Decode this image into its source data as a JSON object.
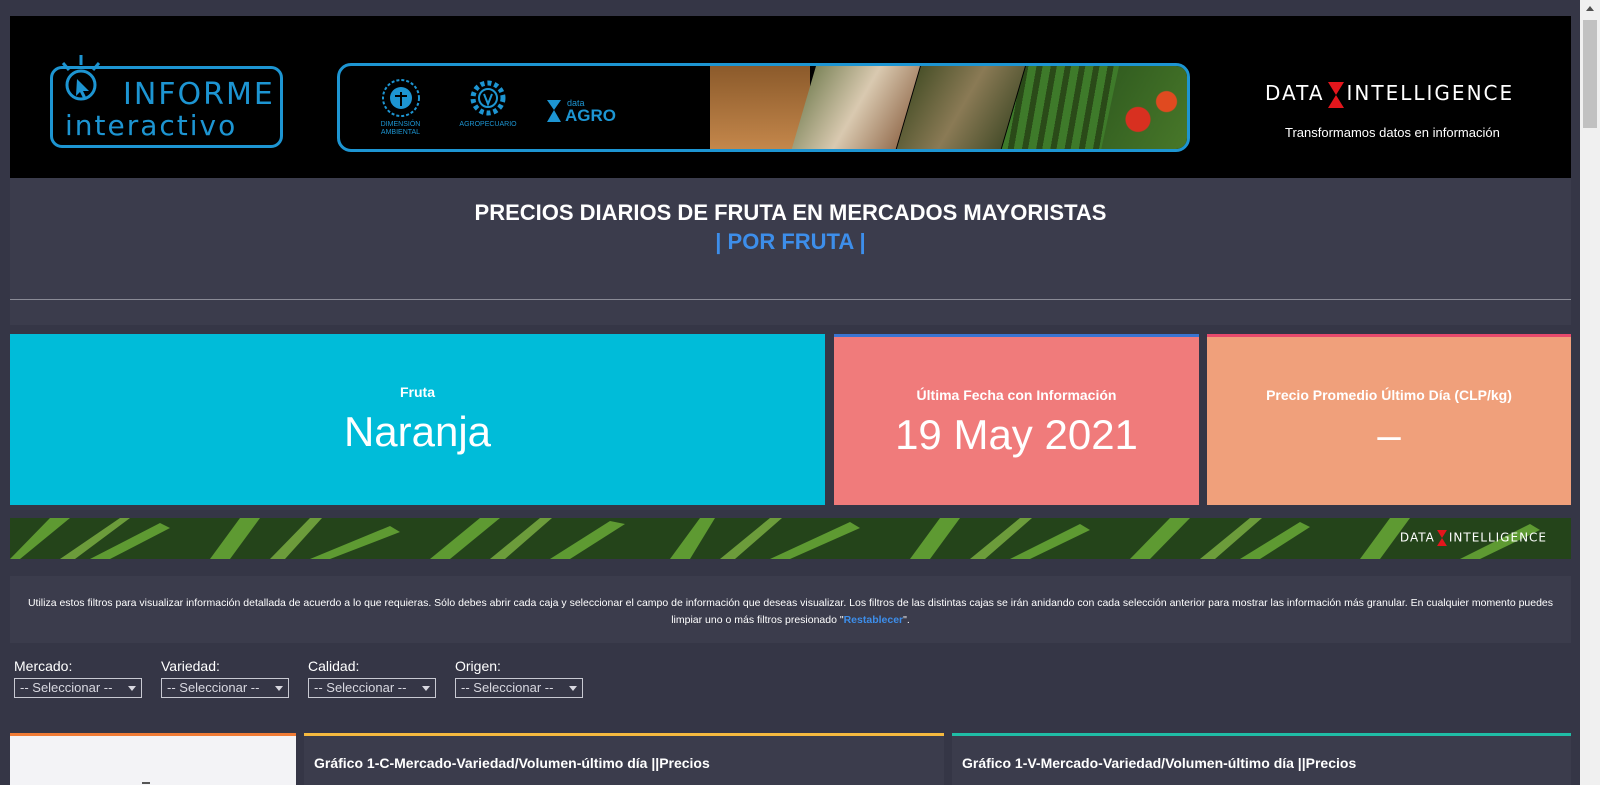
{
  "banner": {
    "logo_word1": "INFORME",
    "logo_word2": "interactivo",
    "partners": [
      {
        "name": "DIMENSIÓN AMBIENTAL",
        "icon": "globe-seal-icon"
      },
      {
        "name": "AGROPECUARIO",
        "icon": "gear-seal-icon"
      },
      {
        "name": "data AGRO",
        "icon": "data-agro-logo"
      }
    ],
    "brand_left": "DATA",
    "brand_right": "INTELLIGENCE",
    "brand_tagline": "Transformamos datos en información"
  },
  "header": {
    "title": "PRECIOS DIARIOS DE FRUTA EN MERCADOS MAYORISTAS",
    "subtitle": "| POR FRUTA |"
  },
  "kpis": {
    "fruta": {
      "label": "Fruta",
      "value": "Naranja"
    },
    "fecha": {
      "label": "Última Fecha con Información",
      "value": "19 May 2021"
    },
    "precio": {
      "label": "Precio Promedio Último Día (CLP/kg)",
      "value": "–"
    }
  },
  "strip": {
    "brand_left": "DATA",
    "brand_right": "INTELLIGENCE"
  },
  "help": {
    "text_before": "Utiliza estos filtros para visualizar información detallada de acuerdo a lo que requieras. Sólo debes abrir cada caja y seleccionar el campo de información que deseas visualizar. Los filtros de las distintas cajas se irán anidando con cada selección anterior para mostrar las información más granular. En cualquier momento puedes limpiar uno o más filtros presionado \"",
    "link": "Restablecer",
    "text_after": "\"."
  },
  "filters": [
    {
      "label": "Mercado:",
      "value": "-- Seleccionar --"
    },
    {
      "label": "Variedad:",
      "value": "-- Seleccionar --"
    },
    {
      "label": "Calidad:",
      "value": "-- Seleccionar --"
    },
    {
      "label": "Origen:",
      "value": "-- Seleccionar --"
    }
  ],
  "cards": {
    "c_title": "Gráfico 1-C-Mercado-Variedad/Volumen-último día ||Precios",
    "v_title": "Gráfico 1-V-Mercado-Variedad/Volumen-último día ||Precios"
  },
  "colors": {
    "accent_blue": "#3d8eea",
    "kpi_cyan": "#00bcd9",
    "kpi_red": "#f07b7b",
    "kpi_orange": "#f0a07b",
    "background": "#353646"
  }
}
